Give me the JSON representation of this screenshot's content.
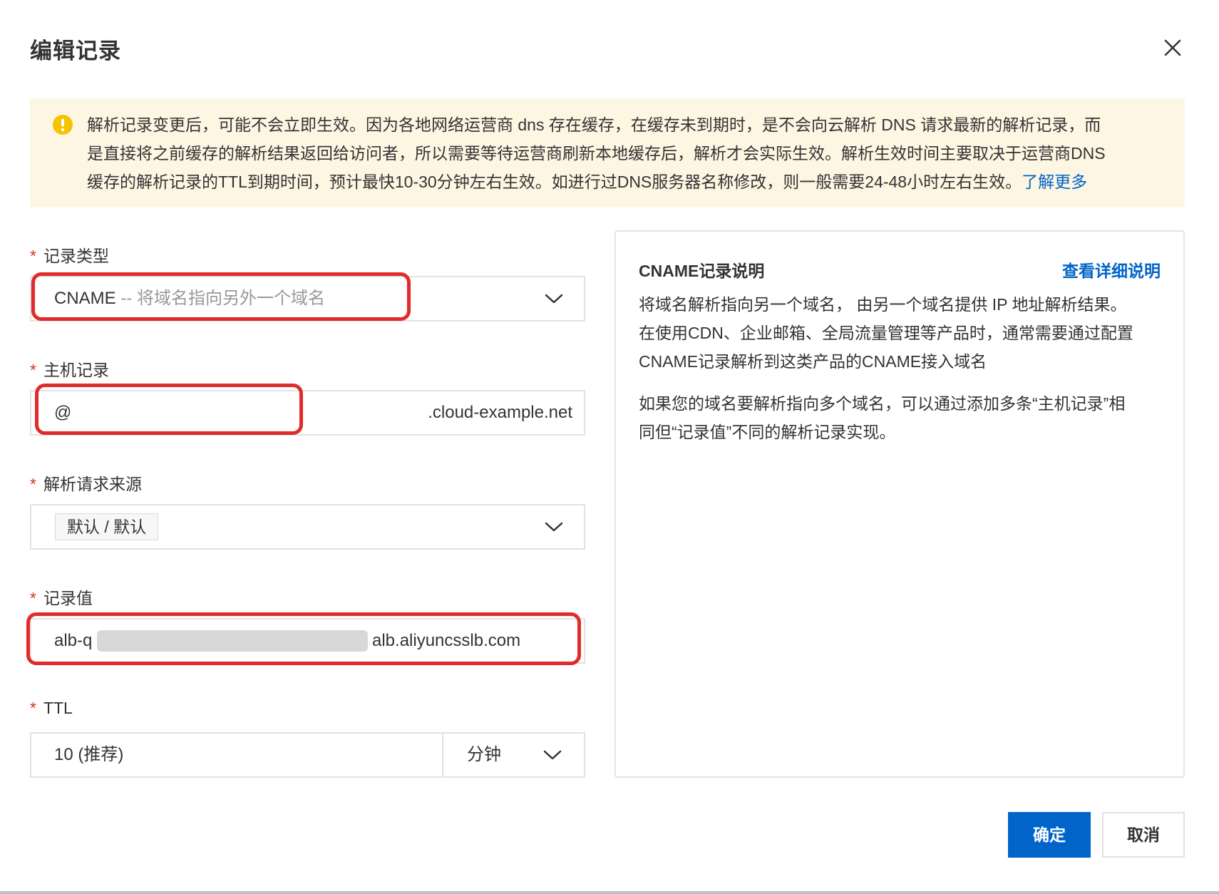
{
  "dialog": {
    "title": "编辑记录"
  },
  "notice": {
    "line1": "解析记录变更后，可能不会立即生效。因为各地网络运营商 dns 存在缓存，在缓存未到期时，是不会向云解析 DNS 请求最新的解析记录，而",
    "line2": "是直接将之前缓存的解析结果返回给访问者，所以需要等待运营商刷新本地缓存后，解析才会实际生效。解析生效时间主要取决于运营商DNS",
    "line3": "缓存的解析记录的TTL到期时间，预计最快10-30分钟左右生效。如进行过DNS服务器名称修改，则一般需要24-48小时左右生效。",
    "link": "了解更多"
  },
  "form": {
    "required_mark": "*",
    "record_type": {
      "label": "记录类型",
      "value": "CNAME",
      "hint": " -- 将域名指向另外一个域名"
    },
    "host": {
      "label": "主机记录",
      "value": "@",
      "suffix": ".cloud-example.net"
    },
    "source": {
      "label": "解析请求来源",
      "tag": "默认 / 默认"
    },
    "record_value": {
      "label": "记录值",
      "prefix": "alb-q",
      "suffix": "alb.aliyuncsslb.com"
    },
    "ttl": {
      "label": "TTL",
      "value": "10 (推荐)",
      "unit": "分钟"
    }
  },
  "info": {
    "title": "CNAME记录说明",
    "link": "查看详细说明",
    "p1_line1": "将域名解析指向另一个域名， 由另一个域名提供 IP 地址解析结果。",
    "p1_line2": "在使用CDN、企业邮箱、全局流量管理等产品时，通常需要通过配置",
    "p1_line3": "CNAME记录解析到这类产品的CNAME接入域名",
    "p2_line1": "如果您的域名要解析指向多个域名，可以通过添加多条“主机记录”相",
    "p2_line2": "同但“记录值”不同的解析记录实现。"
  },
  "footer": {
    "ok": "确定",
    "cancel": "取消"
  },
  "colors": {
    "primary": "#0064c8",
    "highlight": "#e12a2a",
    "notice_bg": "#fdf6e3",
    "warning": "#f5c400"
  }
}
